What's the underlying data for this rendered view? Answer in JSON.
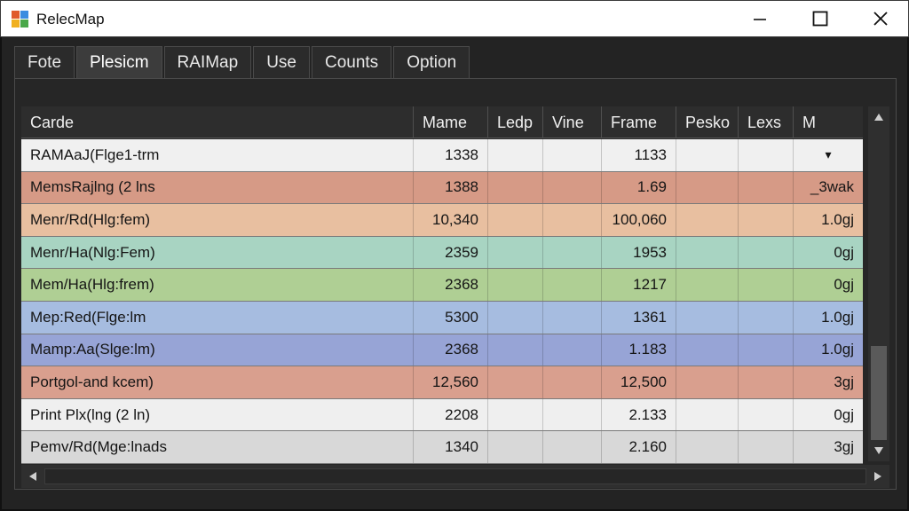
{
  "window": {
    "title": "RelecMap",
    "controls": {
      "minimize": "minimize",
      "maximize": "maximize",
      "close": "close"
    }
  },
  "tabs": [
    {
      "label": "Fote",
      "active": false
    },
    {
      "label": "Plesicm",
      "active": true
    },
    {
      "label": "RAIMap",
      "active": false
    },
    {
      "label": "Use",
      "active": false
    },
    {
      "label": "Counts",
      "active": false
    },
    {
      "label": "Option",
      "active": false
    }
  ],
  "table": {
    "columns": [
      "Carde",
      "Mame",
      "Ledp",
      "Vine",
      "Frame",
      "Pesko",
      "Lexs",
      "M"
    ],
    "rows": [
      {
        "cells": [
          "RAMAaJ(Flge1-trm",
          "1338",
          "",
          "",
          "1133",
          "",
          "",
          "▾"
        ],
        "color": "#f0f0f0"
      },
      {
        "cells": [
          "MemsRajlng (2 lns",
          "1388",
          "",
          "",
          "1.69",
          "",
          "",
          "_3wak"
        ],
        "color": "#d69a86"
      },
      {
        "cells": [
          "Menr/Rd(Hlg:fem)",
          "10,340",
          "",
          "",
          "100,060",
          "",
          "",
          "1.0gj"
        ],
        "color": "#e8bfa0"
      },
      {
        "cells": [
          "Menr/Ha(Nlg:Fem)",
          "2359",
          "",
          "",
          "1953",
          "",
          "",
          "0gj"
        ],
        "color": "#a8d4c2"
      },
      {
        "cells": [
          "Mem/Ha(Hlg:frem)",
          "2368",
          "",
          "",
          "1217",
          "",
          "",
          "0gj"
        ],
        "color": "#afcf94"
      },
      {
        "cells": [
          "Mep:Red(Flge:lm",
          "5300",
          "",
          "",
          "1361",
          "",
          "",
          "1.0gj"
        ],
        "color": "#a6bce0"
      },
      {
        "cells": [
          "Mamp:Aa(Slge:lm)",
          "2368",
          "",
          "",
          "1.183",
          "",
          "",
          "1.0gj"
        ],
        "color": "#97a4d6"
      },
      {
        "cells": [
          "Portgol-and kcem)",
          "12,560",
          "",
          "",
          "12,500",
          "",
          "",
          "3gj"
        ],
        "color": "#d99f8e"
      },
      {
        "cells": [
          "Print Plx(lng (2 ln)",
          "2208",
          "",
          "",
          "2.133",
          "",
          "",
          "0gj"
        ],
        "color": "#efefef"
      },
      {
        "cells": [
          "Pemv/Rd(Mge:lnads",
          "1340",
          "",
          "",
          "2.160",
          "",
          "",
          "3gj"
        ],
        "color": "#d8d8d8"
      }
    ]
  },
  "icons": {
    "app": "app-grid-icon",
    "scroll_up": "scroll-up-arrow-icon",
    "scroll_down": "scroll-down-arrow-icon",
    "scroll_left": "scroll-left-arrow-icon",
    "scroll_right": "scroll-right-arrow-icon"
  },
  "colors": {
    "titlebar": "#ffffff",
    "window_bg": "#232323",
    "header_bg": "#2d2d2d"
  }
}
